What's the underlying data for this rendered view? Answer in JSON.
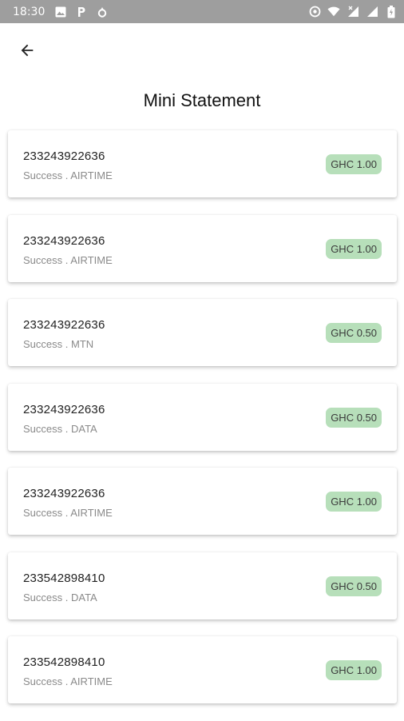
{
  "status_bar": {
    "time": "18:30",
    "left_icons": [
      "image-icon",
      "p-icon",
      "drop-icon"
    ],
    "right_icons": [
      "sync-icon",
      "wifi-icon",
      "signal-icon",
      "signal-icon",
      "battery-icon"
    ]
  },
  "app_bar": {
    "back_icon": "arrow-left-icon"
  },
  "title": "Mini Statement",
  "transactions": [
    {
      "phone": "233243922636",
      "status": "Success",
      "type": "AIRTIME",
      "amount": "GHC 1.00"
    },
    {
      "phone": "233243922636",
      "status": "Success",
      "type": "AIRTIME",
      "amount": "GHC 1.00"
    },
    {
      "phone": "233243922636",
      "status": "Success",
      "type": "MTN",
      "amount": "GHC 0.50"
    },
    {
      "phone": "233243922636",
      "status": "Success",
      "type": "DATA",
      "amount": "GHC 0.50"
    },
    {
      "phone": "233243922636",
      "status": "Success",
      "type": "AIRTIME",
      "amount": "GHC 1.00"
    },
    {
      "phone": "233542898410",
      "status": "Success",
      "type": "DATA",
      "amount": "GHC 0.50"
    },
    {
      "phone": "233542898410",
      "status": "Success",
      "type": "AIRTIME",
      "amount": "GHC 1.00"
    }
  ],
  "colors": {
    "status_bar": "#9e9e9e",
    "badge_bg": "#b7dfba"
  }
}
